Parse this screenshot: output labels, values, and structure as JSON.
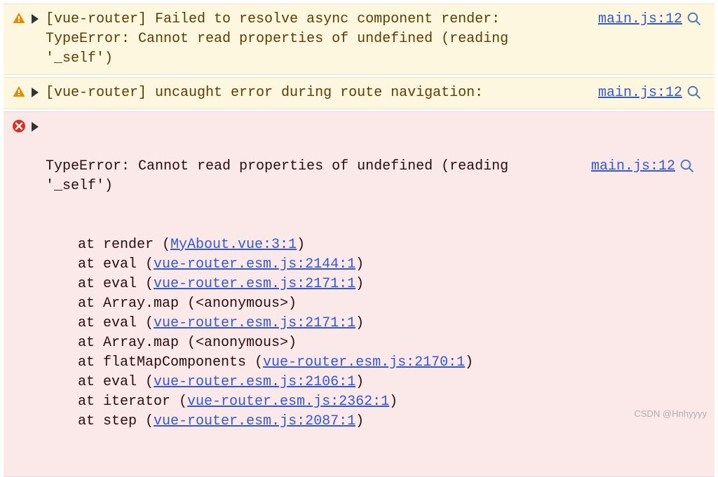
{
  "messages": [
    {
      "level": "warning",
      "text": "[vue-router] Failed to resolve async component render: TypeError: Cannot read properties of undefined (reading '_self')",
      "source": "main.js:12"
    },
    {
      "level": "warning",
      "text": "[vue-router] uncaught error during route navigation:",
      "source": "main.js:12"
    },
    {
      "level": "error",
      "text": "TypeError: Cannot read properties of undefined (reading '_self')",
      "source": "main.js:12",
      "stack": [
        {
          "prefix": "at render (",
          "link": "MyAbout.vue:3:1",
          "suffix": ")"
        },
        {
          "prefix": "at eval (",
          "link": "vue-router.esm.js:2144:1",
          "suffix": ")"
        },
        {
          "prefix": "at eval (",
          "link": "vue-router.esm.js:2171:1",
          "suffix": ")"
        },
        {
          "prefix": "at Array.map (<anonymous>)",
          "link": "",
          "suffix": ""
        },
        {
          "prefix": "at eval (",
          "link": "vue-router.esm.js:2171:1",
          "suffix": ")"
        },
        {
          "prefix": "at Array.map (<anonymous>)",
          "link": "",
          "suffix": ""
        },
        {
          "prefix": "at flatMapComponents (",
          "link": "vue-router.esm.js:2170:1",
          "suffix": ")"
        },
        {
          "prefix": "at eval (",
          "link": "vue-router.esm.js:2106:1",
          "suffix": ")"
        },
        {
          "prefix": "at iterator (",
          "link": "vue-router.esm.js:2362:1",
          "suffix": ")"
        },
        {
          "prefix": "at step (",
          "link": "vue-router.esm.js:2087:1",
          "suffix": ")"
        }
      ]
    }
  ],
  "watermark": "CSDN @Hnhyyyy"
}
